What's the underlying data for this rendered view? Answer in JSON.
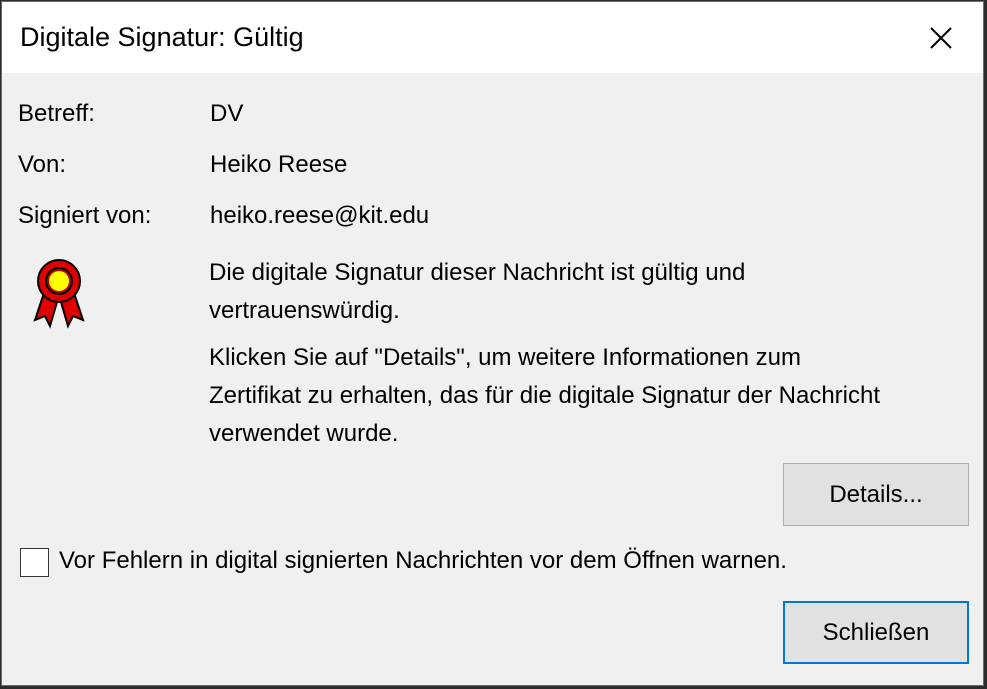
{
  "dialog": {
    "title": "Digitale Signatur: Gültig",
    "close_icon": "close-icon"
  },
  "fields": {
    "subject_label": "Betreff:",
    "subject_value": "DV",
    "from_label": "Von:",
    "from_value": "Heiko Reese",
    "signed_by_label": "Signiert von:",
    "signed_by_value": "heiko.reese@kit.edu"
  },
  "badge_icon": "certificate-rosette-icon",
  "message": {
    "line1": "Die digitale Signatur dieser Nachricht ist gültig und",
    "line2": "vertrauenswürdig.",
    "line3": "Klicken Sie auf \"Details\", um weitere Informationen zum",
    "line4": "Zertifikat zu erhalten, das für die digitale Signatur der Nachricht",
    "line5": "verwendet wurde."
  },
  "buttons": {
    "details": "Details...",
    "close": "Schließen"
  },
  "checkbox": {
    "label": "Vor Fehlern in digital signierten Nachrichten vor dem Öffnen warnen.",
    "checked": false
  },
  "colors": {
    "accent": "#0078d7",
    "badge_red": "#e00000",
    "badge_yellow": "#ffff00"
  }
}
